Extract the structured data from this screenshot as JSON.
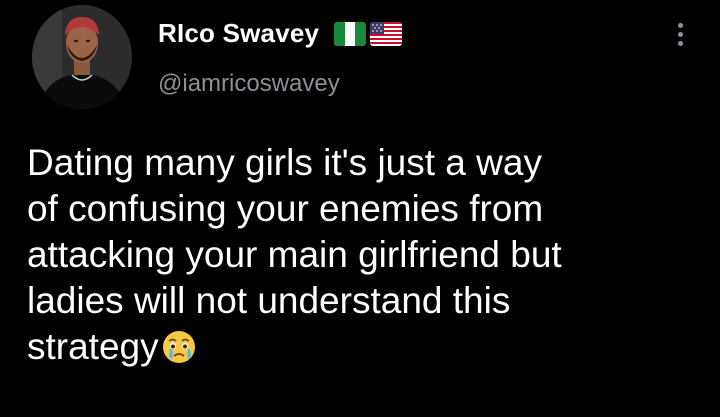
{
  "user": {
    "display_name": "RIco Swavey",
    "handle": "@iamricoswavey",
    "flags": [
      "nigeria-flag",
      "usa-flag"
    ]
  },
  "tweet": {
    "lines": [
      "Dating many girls it's just a way",
      "of confusing your enemies from",
      "attacking your main girlfriend but",
      "ladies will not understand this",
      "strategy"
    ],
    "trailing_emoji": "crying-face-emoji"
  },
  "icons": {
    "more": "more-vertical-icon"
  },
  "colors": {
    "background": "#000000",
    "text_primary": "#ffffff",
    "text_secondary": "#8b9196"
  }
}
